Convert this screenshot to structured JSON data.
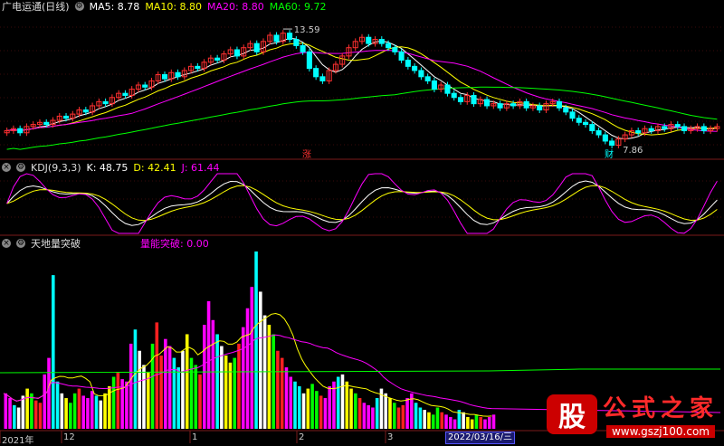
{
  "chart_data": [
    {
      "type": "candlestick",
      "panel": "main",
      "title": "广电运通(日线)",
      "legend": [
        {
          "name": "MA5",
          "value": "8.78",
          "color": "#ffffff"
        },
        {
          "name": "MA10",
          "value": "8.80",
          "color": "#ffff00"
        },
        {
          "name": "MA20",
          "value": "8.80",
          "color": "#ff00ff"
        },
        {
          "name": "MA60",
          "value": "9.72",
          "color": "#00ff00"
        }
      ],
      "annotations": {
        "high": "13.59",
        "low": "7.86",
        "up_tag": "涨",
        "low_tag": "财"
      },
      "ylim": [
        7.4,
        14.2
      ],
      "closes": [
        8.6,
        8.7,
        8.5,
        8.8,
        8.9,
        9.0,
        8.9,
        9.1,
        9.3,
        9.2,
        9.4,
        9.6,
        9.5,
        9.8,
        10.0,
        9.9,
        10.2,
        10.4,
        10.3,
        10.6,
        10.8,
        10.7,
        11.0,
        11.3,
        11.1,
        11.4,
        11.2,
        11.5,
        11.7,
        11.6,
        11.9,
        12.1,
        12.0,
        12.3,
        12.5,
        12.2,
        12.6,
        12.8,
        12.4,
        12.9,
        13.2,
        12.9,
        13.3,
        13.0,
        12.7,
        12.4,
        11.6,
        11.2,
        11.0,
        11.5,
        11.8,
        12.2,
        12.6,
        12.9,
        13.1,
        12.8,
        13.0,
        12.8,
        12.6,
        12.4,
        12.0,
        11.7,
        11.5,
        11.2,
        11.0,
        10.6,
        10.8,
        10.4,
        10.2,
        10.0,
        10.3,
        9.9,
        10.1,
        9.8,
        9.9,
        9.7,
        9.9,
        9.8,
        10.0,
        9.7,
        9.8,
        9.6,
        9.9,
        10.0,
        9.7,
        9.5,
        9.2,
        9.0,
        8.9,
        8.6,
        8.4,
        8.1,
        7.9,
        8.2,
        8.4,
        8.6,
        8.5,
        8.7,
        8.6,
        8.8,
        8.7,
        8.9,
        8.8,
        8.6,
        8.7,
        8.8,
        8.6,
        8.7,
        8.8
      ]
    },
    {
      "type": "line",
      "panel": "kdj",
      "title": "KDJ(9,3,3)",
      "legend": [
        {
          "name": "K",
          "value": "48.75",
          "color": "#ffffff"
        },
        {
          "name": "D",
          "value": "42.41",
          "color": "#ffff00"
        },
        {
          "name": "J",
          "value": "61.44",
          "color": "#ff00ff"
        }
      ],
      "ylim": [
        0,
        100
      ]
    },
    {
      "type": "bar",
      "panel": "volume",
      "title": "天地量突破",
      "legend": [
        {
          "name": "量能突破",
          "value": "0.00",
          "color": "#ff00ff"
        }
      ],
      "x_ticks": [
        "2021年",
        "12",
        "1",
        "2",
        "3"
      ],
      "current_date": "2022/03/16/三",
      "colors": [
        "#ff00ff",
        "#00ffff",
        "#ffff00",
        "#ff2020",
        "#ff00ff",
        "#ffffff",
        "#00ff00"
      ],
      "values": [
        30,
        26,
        20,
        18,
        28,
        34,
        30,
        24,
        22,
        46,
        60,
        130,
        40,
        30,
        26,
        22,
        30,
        34,
        28,
        26,
        32,
        28,
        24,
        30,
        36,
        44,
        48,
        42,
        40,
        72,
        84,
        66,
        54,
        48,
        72,
        90,
        62,
        76,
        70,
        60,
        52,
        66,
        80,
        60,
        54,
        46,
        88,
        108,
        92,
        80,
        70,
        62,
        56,
        60,
        72,
        86,
        102,
        120,
        150,
        116,
        96,
        88,
        80,
        66,
        60,
        52,
        44,
        40,
        36,
        30,
        34,
        38,
        32,
        28,
        26,
        36,
        40,
        44,
        46,
        40,
        34,
        30,
        26,
        22,
        20,
        18,
        26,
        34,
        30,
        26,
        22,
        18,
        20,
        26,
        30,
        22,
        18,
        16,
        14,
        12,
        18,
        14,
        12,
        10,
        8,
        16,
        14,
        10,
        8,
        12,
        10,
        8,
        10,
        12
      ]
    }
  ],
  "watermark": {
    "mark": "股",
    "title": "公式之家",
    "url": "www.gszj100.com"
  }
}
